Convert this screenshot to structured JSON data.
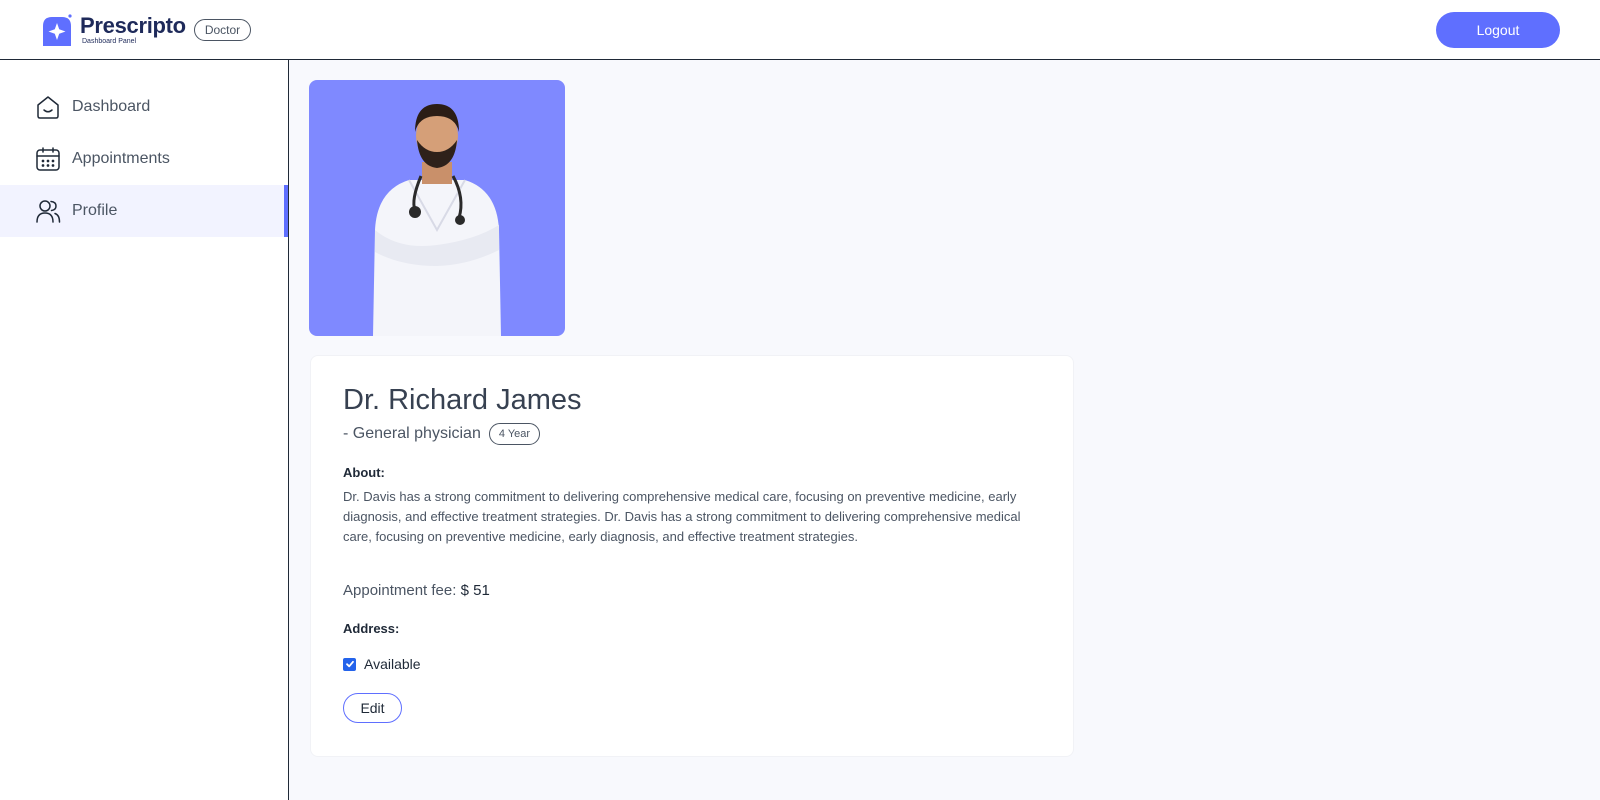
{
  "header": {
    "brand_name": "Prescripto",
    "brand_sub": "Dashboard Panel",
    "role_badge": "Doctor",
    "logout_label": "Logout",
    "accent_color": "#5f6fff"
  },
  "sidebar": {
    "items": [
      {
        "label": "Dashboard",
        "icon": "home-icon",
        "active": false
      },
      {
        "label": "Appointments",
        "icon": "calendar-icon",
        "active": false
      },
      {
        "label": "Profile",
        "icon": "people-icon",
        "active": true
      }
    ]
  },
  "profile": {
    "photo_icon": "doctor-photo",
    "name": "Dr. Richard James",
    "speciality": "- General physician",
    "experience": "4 Year",
    "about_label": "About:",
    "about_text": "Dr. Davis has a strong commitment to delivering comprehensive medical care, focusing on preventive medicine, early diagnosis, and effective treatment strategies. Dr. Davis has a strong commitment to delivering comprehensive medical care, focusing on preventive medicine, early diagnosis, and effective treatment strategies.",
    "fee_label": "Appointment fee:",
    "fee_value": "$ 51",
    "address_label": "Address:",
    "available_label": "Available",
    "available": true,
    "edit_label": "Edit"
  }
}
